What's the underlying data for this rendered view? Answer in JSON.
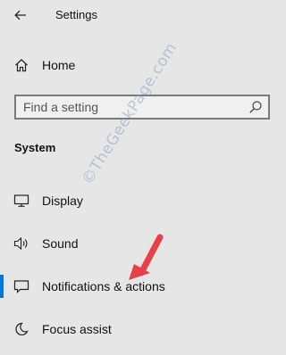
{
  "window": {
    "title": "Settings"
  },
  "nav_home": {
    "label": "Home",
    "icon": "home-icon"
  },
  "search": {
    "placeholder": "Find a setting",
    "icon": "search-icon"
  },
  "section": {
    "title": "System"
  },
  "items": [
    {
      "label": "Display",
      "icon": "display-icon"
    },
    {
      "label": "Sound",
      "icon": "sound-icon"
    },
    {
      "label": "Notifications & actions",
      "icon": "notifications-icon",
      "selected": true
    },
    {
      "label": "Focus assist",
      "icon": "moon-icon"
    }
  ],
  "watermark": {
    "text": "©TheGeekPage.com"
  },
  "colors": {
    "background": "#e6e6e6",
    "accent": "#0078d7",
    "annotation_arrow": "#e8404a"
  }
}
